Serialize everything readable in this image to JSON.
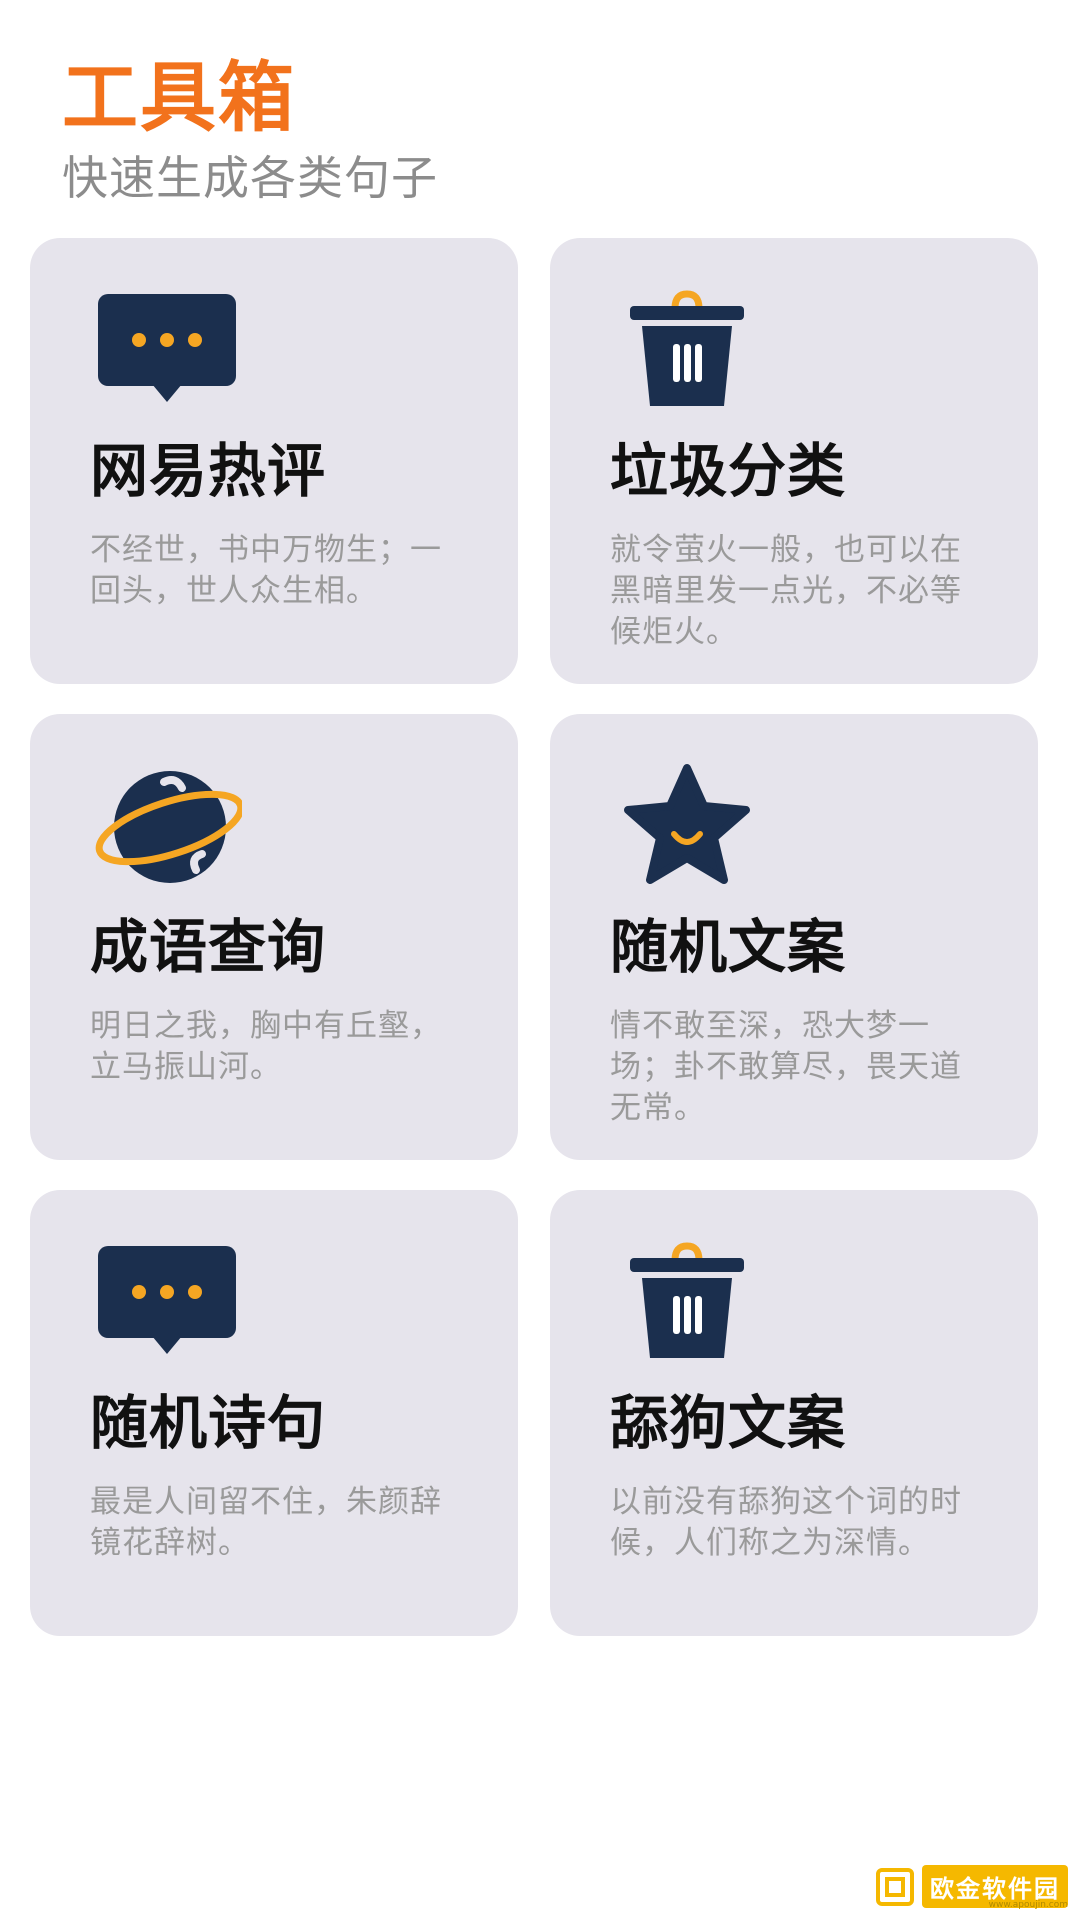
{
  "header": {
    "title": "工具箱",
    "subtitle": "快速生成各类句子"
  },
  "cards": [
    {
      "title": "网易热评",
      "desc": "不经世，书中万物生；一回头，世人众生相。",
      "icon": "message-bubble-icon"
    },
    {
      "title": "垃圾分类",
      "desc": "就令萤火一般，也可以在黑暗里发一点光，不必等候炬火。",
      "icon": "trash-bin-icon"
    },
    {
      "title": "成语查询",
      "desc": "明日之我，胸中有丘壑，立马振山河。",
      "icon": "planet-icon"
    },
    {
      "title": "随机文案",
      "desc": "情不敢至深，恐大梦一场；卦不敢算尽，畏天道无常。",
      "icon": "star-icon"
    },
    {
      "title": "随机诗句",
      "desc": "最是人间留不住，朱颜辞镜花辞树。",
      "icon": "message-bubble-icon"
    },
    {
      "title": "舔狗文案",
      "desc": "以前没有舔狗这个词的时候，人们称之为深情。",
      "icon": "trash-bin-icon"
    }
  ],
  "watermark": {
    "text": "欧金软件园",
    "url": "www.apoujin.com"
  },
  "colors": {
    "accent": "#f2721c",
    "icon_dark": "#1b2f4e",
    "icon_orange": "#f5a623",
    "card_bg": "#e6e4ec"
  }
}
